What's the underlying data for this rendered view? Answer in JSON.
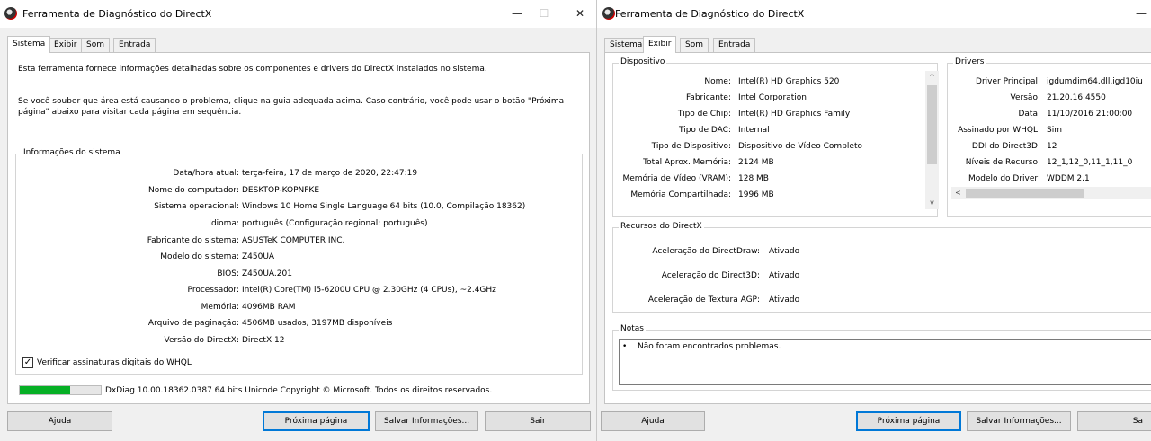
{
  "left_window": {
    "title": "Ferramenta de Diagnóstico do DirectX",
    "controls": {
      "minimize": "—",
      "maximize": "☐",
      "close": "✕"
    },
    "tabs": [
      "Sistema",
      "Exibir",
      "Som",
      "Entrada"
    ],
    "active_tab": "Sistema",
    "intro_text": "Esta ferramenta fornece informações detalhadas sobre os componentes e drivers do DirectX instalados no sistema.",
    "help_text_1": "Se você souber que área está causando o problema, clique na guia adequada acima. Caso contrário, você pode usar o botão \"Próxima",
    "help_text_2": "página\" abaixo para visitar cada página em sequência.",
    "system_info": {
      "legend": "Informações do sistema",
      "rows": [
        {
          "label": "Data/hora atual:",
          "value": "terça-feira, 17 de março de 2020, 22:47:19"
        },
        {
          "label": "Nome do computador:",
          "value": "DESKTOP-KOPNFKE"
        },
        {
          "label": "Sistema operacional:",
          "value": "Windows 10 Home Single Language 64 bits (10.0, Compilação 18362)"
        },
        {
          "label": "Idioma:",
          "value": "português (Configuração regional: português)"
        },
        {
          "label": "Fabricante do sistema:",
          "value": "ASUSTeK COMPUTER INC."
        },
        {
          "label": "Modelo do sistema:",
          "value": "Z450UA"
        },
        {
          "label": "BIOS:",
          "value": "Z450UA.201"
        },
        {
          "label": "Processador:",
          "value": "Intel(R) Core(TM) i5-6200U CPU @ 2.30GHz (4 CPUs), ~2.4GHz"
        },
        {
          "label": "Memória:",
          "value": "4096MB RAM"
        },
        {
          "label": "Arquivo de paginação:",
          "value": "4506MB usados, 3197MB disponíveis"
        },
        {
          "label": "Versão do DirectX:",
          "value": "DirectX 12"
        }
      ]
    },
    "whql_checkbox": {
      "label": "Verificar assinaturas digitais do WHQL",
      "checked": true,
      "mark": "✓"
    },
    "progress_fraction": 0.62,
    "status_text": "DxDiag 10.00.18362.0387 64 bits Unicode  Copyright © Microsoft. Todos os direitos reservados.",
    "buttons": {
      "help": "Ajuda",
      "next": "Próxima página",
      "save": "Salvar Informações...",
      "exit": "Sair"
    }
  },
  "right_window": {
    "title": "Ferramenta de Diagnóstico do DirectX",
    "controls": {
      "minimize": "—"
    },
    "tabs": [
      "Sistema",
      "Exibir",
      "Som",
      "Entrada"
    ],
    "active_tab": "Exibir",
    "device": {
      "legend": "Dispositivo",
      "rows": [
        {
          "label": "Nome:",
          "value": "Intel(R) HD Graphics 520"
        },
        {
          "label": "Fabricante:",
          "value": "Intel Corporation"
        },
        {
          "label": "Tipo de Chip:",
          "value": "Intel(R) HD Graphics Family"
        },
        {
          "label": "Tipo de DAC:",
          "value": "Internal"
        },
        {
          "label": "Tipo de Dispositivo:",
          "value": "Dispositivo de Vídeo Completo"
        },
        {
          "label": "Total Aprox. Memória:",
          "value": "2124 MB"
        },
        {
          "label": "Memória de Vídeo (VRAM):",
          "value": "128 MB"
        },
        {
          "label": "Memória Compartilhada:",
          "value": "1996 MB"
        }
      ]
    },
    "drivers": {
      "legend": "Drivers",
      "rows": [
        {
          "label": "Driver Principal:",
          "value": "igdumdim64.dll,igd10iu"
        },
        {
          "label": "Versão:",
          "value": "21.20.16.4550"
        },
        {
          "label": "Data:",
          "value": "11/10/2016 21:00:00"
        },
        {
          "label": "Assinado por WHQL:",
          "value": "Sim"
        },
        {
          "label": "DDI do Direct3D:",
          "value": "12"
        },
        {
          "label": "Níveis de Recurso:",
          "value": "12_1,12_0,11_1,11_0"
        },
        {
          "label": "Modelo do Driver:",
          "value": "WDDM 2.1"
        }
      ]
    },
    "directx_features": {
      "legend": "Recursos do DirectX",
      "rows": [
        {
          "label": "Aceleração do DirectDraw:",
          "value": "Ativado"
        },
        {
          "label": "Aceleração do Direct3D:",
          "value": "Ativado"
        },
        {
          "label": "Aceleração de Textura AGP:",
          "value": "Ativado"
        }
      ]
    },
    "notes": {
      "legend": "Notas",
      "items": [
        "Não foram encontrados problemas."
      ],
      "bullet": "•"
    },
    "scroll_arrows": {
      "up": "^",
      "down": "v",
      "left": "<"
    },
    "buttons": {
      "help": "Ajuda",
      "next": "Próxima página",
      "save": "Salvar Informações...",
      "exit": "Sa"
    }
  }
}
